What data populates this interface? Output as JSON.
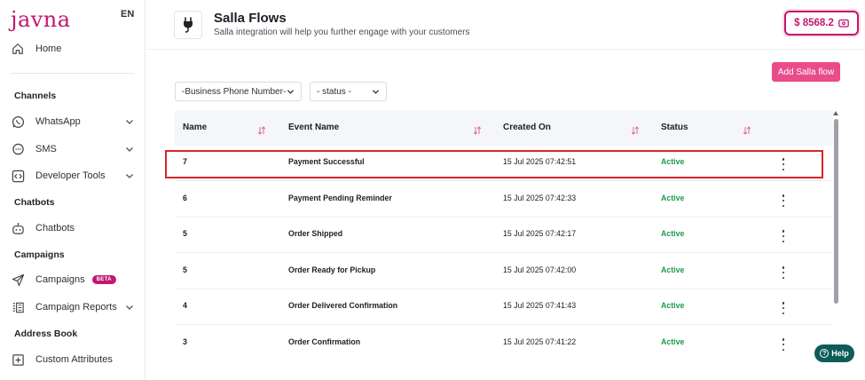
{
  "brand": {
    "logo_text": "javna",
    "accent": "#c3166f"
  },
  "lang": "EN",
  "sidebar": {
    "home": {
      "label": "Home",
      "icon": "home-icon"
    },
    "channels_heading": "Channels",
    "whatsapp": {
      "label": "WhatsApp",
      "icon": "whatsapp-icon"
    },
    "sms": {
      "label": "SMS",
      "icon": "chat-bubble-icon"
    },
    "developer_tools": {
      "label": "Developer Tools",
      "icon": "code-icon"
    },
    "chatbots_heading": "Chatbots",
    "chatbots": {
      "label": "Chatbots",
      "icon": "robot-icon"
    },
    "campaigns_heading": "Campaigns",
    "campaigns": {
      "label": "Campaigns",
      "badge": "BETA",
      "icon": "send-icon"
    },
    "campaign_reports": {
      "label": "Campaign Reports",
      "icon": "report-icon"
    },
    "address_book_heading": "Address Book",
    "custom_attributes": {
      "label": "Custom Attributes",
      "icon": "add-box-icon"
    }
  },
  "header": {
    "icon": "plug-icon",
    "title": "Salla Flows",
    "subtitle": "Salla integration will help you further engage with your customers",
    "balance": "$ 8568.2"
  },
  "actions": {
    "add_label": "Add Salla flow"
  },
  "filters": {
    "phone": "-Business Phone Number-",
    "status": "- status -"
  },
  "table": {
    "headers": {
      "name": "Name",
      "event": "Event Name",
      "created": "Created On",
      "status": "Status"
    },
    "rows": [
      {
        "name": "7",
        "event": "Payment Successful",
        "created": "15 Jul 2025 07:42:51",
        "status": "Active"
      },
      {
        "name": "6",
        "event": "Payment Pending Reminder",
        "created": "15 Jul 2025 07:42:33",
        "status": "Active"
      },
      {
        "name": "5",
        "event": "Order Shipped",
        "created": "15 Jul 2025 07:42:17",
        "status": "Active"
      },
      {
        "name": "5",
        "event": "Order Ready for Pickup",
        "created": "15 Jul 2025 07:42:00",
        "status": "Active"
      },
      {
        "name": "4",
        "event": "Order Delivered Confirmation",
        "created": "15 Jul 2025 07:41:43",
        "status": "Active"
      },
      {
        "name": "3",
        "event": "Order Confirmation",
        "created": "15 Jul 2025 07:41:22",
        "status": "Active"
      }
    ]
  },
  "help": {
    "label": "Help"
  }
}
